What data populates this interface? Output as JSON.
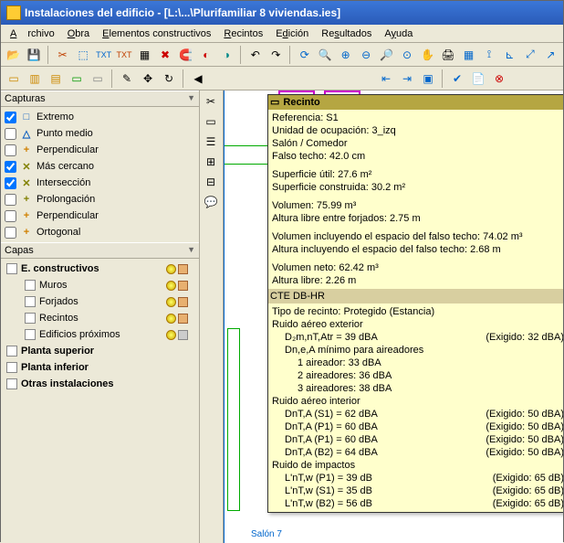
{
  "title": "Instalaciones del edificio - [L:\\...\\Plurifamiliar 8 viviendas.ies]",
  "menu": {
    "archivo": "Archivo",
    "obra": "Obra",
    "elementos": "Elementos constructivos",
    "recintos": "Recintos",
    "edicion": "Edición",
    "resultados": "Resultados",
    "ayuda": "Ayuda"
  },
  "panels": {
    "capturas": "Capturas",
    "capas": "Capas"
  },
  "captures": [
    {
      "checked": true,
      "icon": "□",
      "color": "#1060c0",
      "label": "Extremo"
    },
    {
      "checked": false,
      "icon": "△",
      "color": "#1060c0",
      "label": "Punto medio"
    },
    {
      "checked": false,
      "icon": "+",
      "color": "#d08000",
      "label": "Perpendicular"
    },
    {
      "checked": true,
      "icon": "✕",
      "color": "#808000",
      "label": "Más cercano"
    },
    {
      "checked": true,
      "icon": "✕",
      "color": "#808000",
      "label": "Intersección"
    },
    {
      "checked": false,
      "icon": "+",
      "color": "#808000",
      "label": "Prolongación"
    },
    {
      "checked": false,
      "icon": "+",
      "color": "#d08000",
      "label": "Perpendicular"
    },
    {
      "checked": false,
      "icon": "+",
      "color": "#d08000",
      "label": "Ortogonal"
    }
  ],
  "layers": [
    {
      "type": "parent",
      "bold": true,
      "label": "E. constructivos",
      "bulb": true,
      "cube": "on"
    },
    {
      "type": "child",
      "label": "Muros",
      "bulb": true,
      "cube": "on"
    },
    {
      "type": "child",
      "label": "Forjados",
      "bulb": true,
      "cube": "on"
    },
    {
      "type": "child",
      "label": "Recintos",
      "bulb": true,
      "cube": "on"
    },
    {
      "type": "child",
      "label": "Edificios próximos",
      "bulb": true,
      "cube": "off"
    },
    {
      "type": "parent",
      "bold": true,
      "label": "Planta superior"
    },
    {
      "type": "parent",
      "bold": true,
      "label": "Planta inferior"
    },
    {
      "type": "parent",
      "bold": true,
      "label": "Otras instalaciones"
    }
  ],
  "tooltip": {
    "header": "Recinto",
    "ref": "Referencia: S1",
    "unidad": "Unidad de ocupación: 3_izq",
    "tipo_habitacion": "Salón / Comedor",
    "falso": "Falso techo: 42.0 cm",
    "sup_util": "Superficie útil: 27.6 m²",
    "sup_constr": "Superficie construida: 30.2 m²",
    "volumen": "Volumen: 75.99 m³",
    "altura_libre": "Altura libre entre forjados: 2.75 m",
    "vol_falso": "Volumen incluyendo el espacio del falso techo: 74.02 m³",
    "alt_falso": "Altura incluyendo el espacio del falso techo: 2.68 m",
    "vol_neto": "Volumen neto: 62.42 m³",
    "alt_libre2": "Altura libre: 2.26 m",
    "cte": "CTE DB-HR",
    "tipo_recinto": "Tipo de recinto: Protegido (Estancia)",
    "ruido_ext_t": "Ruido aéreo exterior",
    "d2m": "D₂m,nT,Atr = 39 dBA",
    "d2m_req": "(Exigido: 32 dBA)",
    "dnea": "Dn,e,A mínimo para aireadores",
    "air1": "1 aireador: 33 dBA",
    "air2": "2 aireadores: 36 dBA",
    "air3": "3 aireadores: 38 dBA",
    "ruido_int_t": "Ruido aéreo interior",
    "int_rows": [
      {
        "l": "DnT,A (S1) = 62 dBA",
        "r": "(Exigido: 50 dBA)"
      },
      {
        "l": "DnT,A (P1) = 60 dBA",
        "r": "(Exigido: 50 dBA)"
      },
      {
        "l": "DnT,A (P1) = 60 dBA",
        "r": "(Exigido: 50 dBA)"
      },
      {
        "l": "DnT,A (B2) = 64 dBA",
        "r": "(Exigido: 50 dBA)"
      }
    ],
    "ruido_imp_t": "Ruido de impactos",
    "imp_rows": [
      {
        "l": "L'nT,w (P1) = 39 dB",
        "r": "(Exigido: 65 dB)"
      },
      {
        "l": "L'nT,w (S1) = 35 dB",
        "r": "(Exigido: 65 dB)"
      },
      {
        "l": "L'nT,w (B2) = 56 dB",
        "r": "(Exigido: 65 dB)"
      }
    ]
  },
  "canvas_label": "Salón 7"
}
